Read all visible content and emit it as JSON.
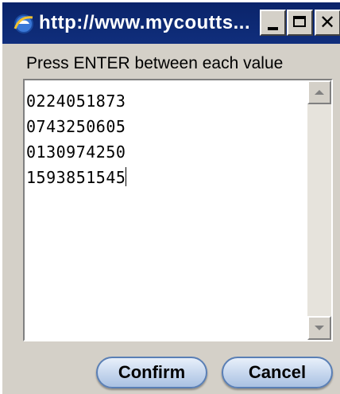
{
  "window": {
    "title": "http://www.mycoutts...",
    "minimize_icon": "minimize-icon",
    "maximize_icon": "maximize-icon",
    "close_icon": "close-icon",
    "app_icon": "internet-explorer-icon"
  },
  "instruction": "Press ENTER between each value",
  "values": [
    "0224051873",
    "0743250605",
    "0130974250",
    "1593851545"
  ],
  "buttons": {
    "confirm": "Confirm",
    "cancel": "Cancel"
  },
  "colors": {
    "titlebar": "#0a246a",
    "window_bg": "#d4d0c8",
    "button_border": "#5a7fb5"
  }
}
